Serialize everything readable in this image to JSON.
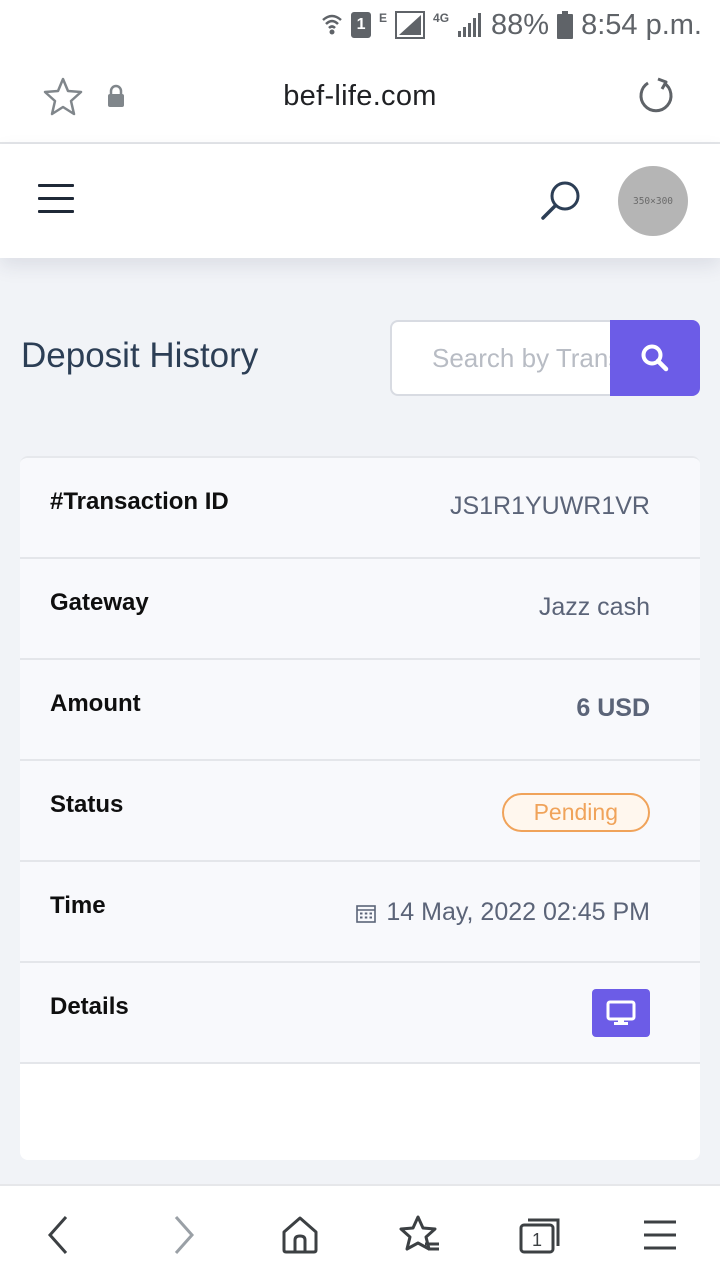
{
  "status_bar": {
    "sim_label": "1",
    "network_e": "E",
    "network_4g": "4G",
    "battery": "88%",
    "time": "8:54 p.m."
  },
  "browser": {
    "url": "bef-life.com",
    "icons": [
      "star-icon",
      "lock-icon",
      "reload-icon"
    ]
  },
  "site_header": {
    "avatar_placeholder": "350×300",
    "icons": [
      "hamburger-icon",
      "search-icon"
    ]
  },
  "page": {
    "title": "Deposit History",
    "search_placeholder": "Search by Transaction ID"
  },
  "deposit": {
    "rows": [
      {
        "label": "#Transaction ID",
        "value": "JS1R1YUWR1VR"
      },
      {
        "label": "Gateway",
        "value": "Jazz cash"
      },
      {
        "label": "Amount",
        "value": "6 USD"
      },
      {
        "label": "Status",
        "value": "Pending"
      },
      {
        "label": "Time",
        "value": "14 May, 2022 02:45 PM"
      },
      {
        "label": "Details",
        "value": ""
      }
    ],
    "status_color": "#f0a35a",
    "accent_color": "#6c5ce7"
  },
  "bottom_nav": {
    "tab_count": "1",
    "icons": [
      "back-icon",
      "forward-icon",
      "home-icon",
      "bookmarks-icon",
      "tabs-icon",
      "menu-icon"
    ]
  }
}
